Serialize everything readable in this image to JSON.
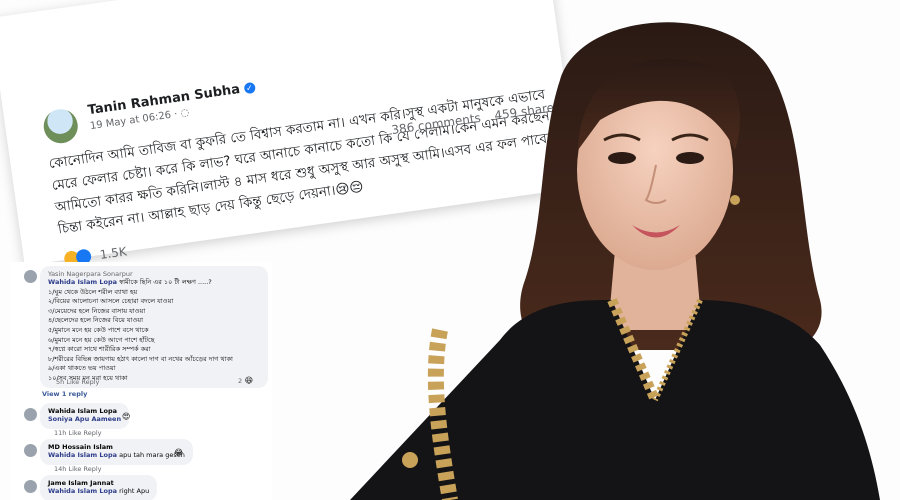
{
  "post": {
    "author": "Tanin Rahman Subha",
    "verified_icon": "verified-badge-icon",
    "timestamp": "19 May at 06:26 ·",
    "body": "কোনোদিন আমি তাবিজ বা কুফরি তে বিশ্বাস করতাম না। এখন করি।সুস্থ একটা মানুষকে এভাবে মেরে ফেলার চেষ্টা। করে কি লাভ? ঘরে আনাচে কানাচে কতো কি যে পেলাম।কেন এমন করছেন।আমিতো কারর ক্ষতি করিনি।লাস্ট ৪ মাস ধরে শুধু অসুস্থ আর অসুস্থ আমি।এসব এর ফল পাবেন চিন্তা কইরেন না। আল্লাহ ছাড় দেয় কিন্তু ছেড়ে দেয়না।😢😔",
    "reactions_count": "1.5K",
    "comments_count": "386 comments",
    "shares_count": "459 shares"
  },
  "comments": [
    {
      "author": "Yasin Nagerpara Sonarpur",
      "tag": "Wahida Islam Lopa",
      "lines": [
        "স্বামীকে ছিনি এর ১০ টী লক্ষণ .....?",
        "১/ঘুম থেকে উঠলে শরীল ব্যাথা হয়",
        "২/বিয়ের আলোচনা আসলে চেহারা বদলে যাওয়া",
        "৩/মেয়েদের হলে নিজের বাসায় যাওয়া",
        "৪/ছেলেদের হলে নিজের বিয়ে যাওয়া",
        "৫/মুমানে মনে হয় কেউ পাশে বসে থাকে",
        "৬/মুমানে মনে হয় কেউ আগে পাশে হাঁটছে",
        "৭/স্বপ্নে কারো সাথে শারীরিক সম্পর্ক করা",
        "৮/শরীরের বিভিন্ন জায়গায় হঠাৎ কালো দাগ বা নখের আঁচড়ের দাগ থাকা",
        "৯/একা থাকতে ভয় পাওয়া",
        "১০/সব সময় মন মরা হয়ে থাকা"
      ],
      "actions": "5h    Like    Reply",
      "reaction_count": "2",
      "view_replies": "View 1 reply"
    },
    {
      "author": "Wahida Islam Lopa",
      "text": "Soniya Apu Aameen",
      "emoji": "😍",
      "actions": "11h    Like    Reply"
    },
    {
      "author": "MD Hossain Islam",
      "tag": "Wahida Islam Lopa",
      "text": "apu tah mara gesen",
      "emoji": "😂",
      "actions": "14h    Like    Reply"
    },
    {
      "author": "Jame Islam Jannat",
      "tag": "Wahida Islam Lopa",
      "text": "right Apu"
    }
  ],
  "colors": {
    "facebook_blue": "#1877f2",
    "text": "#1c1e21",
    "muted": "#65676b",
    "comment_bg": "#f0f2f5",
    "dress": "#141416",
    "embroidery": "#c9a25a"
  }
}
